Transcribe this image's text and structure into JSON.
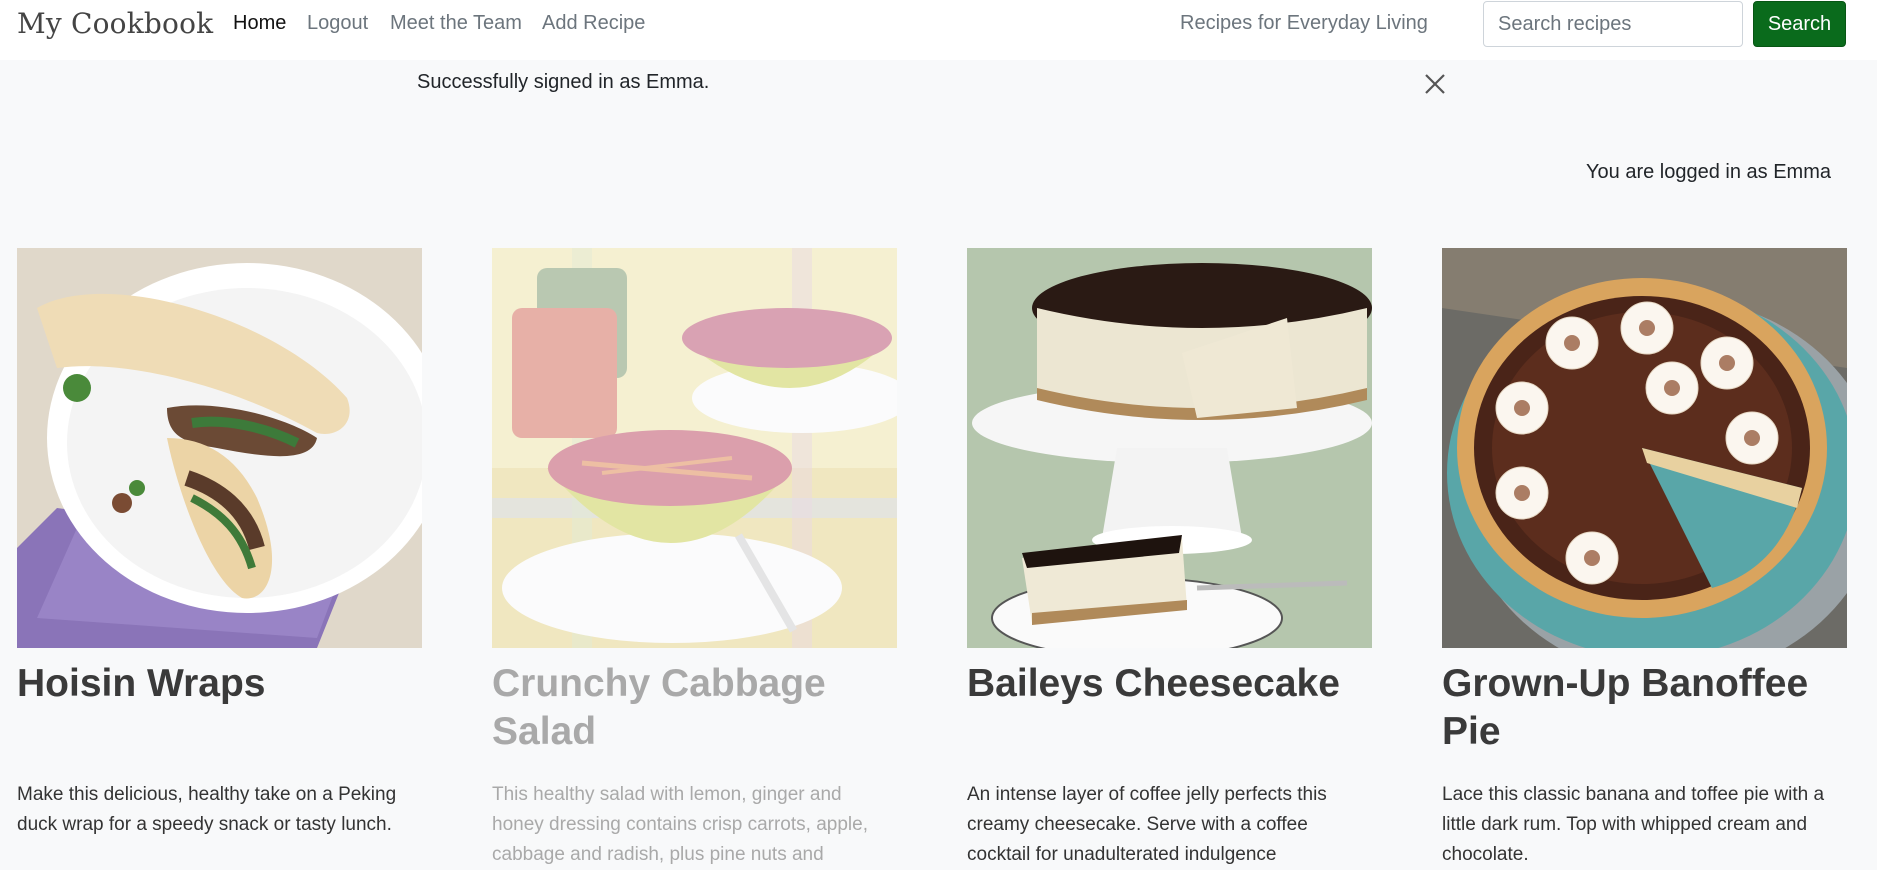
{
  "navbar": {
    "brand": "My Cookbook",
    "links": [
      {
        "label": "Home",
        "active": true
      },
      {
        "label": "Logout"
      },
      {
        "label": "Meet the Team"
      },
      {
        "label": "Add Recipe"
      }
    ],
    "tagline": "Recipes for Everyday Living",
    "search": {
      "placeholder": "Search recipes",
      "button_label": "Search"
    }
  },
  "alert": {
    "message": "Successfully signed in as Emma."
  },
  "status": {
    "logged_in_text": "You are logged in as Emma"
  },
  "recipes": [
    {
      "title": "Hoisin Wraps",
      "description": "Make this delicious, healthy take on a Peking duck wrap for a speedy snack or tasty lunch."
    },
    {
      "title": "Crunchy Cabbage Salad",
      "description": "This healthy salad with lemon, ginger and honey dressing contains crisp carrots, apple, cabbage and radish, plus pine nuts and"
    },
    {
      "title": "Baileys Cheesecake",
      "description": "An intense layer of coffee jelly perfects this creamy cheesecake. Serve with a coffee cocktail for unadulterated indulgence"
    },
    {
      "title": "Grown-Up Banoffee Pie",
      "description": "Lace this classic banana and toffee pie with a little dark rum. Top with whipped cream and chocolate."
    }
  ],
  "colors": {
    "search_button": "#0a6b1c",
    "page_background": "#f8f9fa"
  }
}
